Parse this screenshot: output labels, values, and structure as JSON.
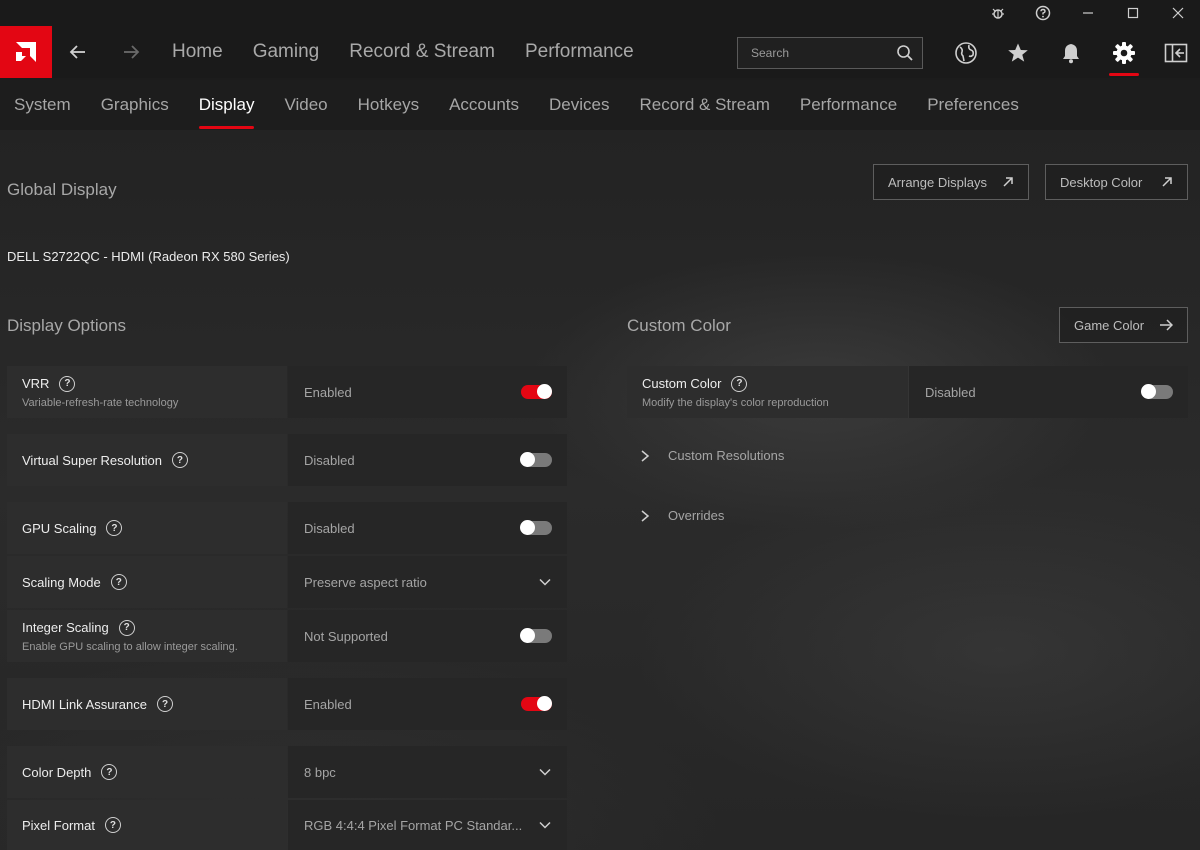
{
  "window_controls": [
    "bug-report",
    "help",
    "minimize",
    "maximize",
    "close"
  ],
  "header": {
    "main_nav": [
      "Home",
      "Gaming",
      "Record & Stream",
      "Performance"
    ],
    "search_placeholder": "Search",
    "icons": [
      "globe-icon",
      "star-icon",
      "bell-icon",
      "gear-icon",
      "sidebar-icon"
    ]
  },
  "subnav": {
    "tabs": [
      "System",
      "Graphics",
      "Display",
      "Video",
      "Hotkeys",
      "Accounts",
      "Devices",
      "Record & Stream",
      "Performance",
      "Preferences"
    ],
    "active": "Display"
  },
  "global": {
    "title": "Global Display",
    "arrange_btn": "Arrange Displays",
    "desktop_color_btn": "Desktop Color",
    "monitor": "DELL S2722QC - HDMI (Radeon RX 580 Series)"
  },
  "display_options": {
    "title": "Display Options",
    "rows": [
      {
        "label": "VRR",
        "desc": "Variable-refresh-rate technology",
        "value": "Enabled",
        "control": "toggle",
        "on": true
      },
      {
        "label": "Virtual Super Resolution",
        "desc": "",
        "value": "Disabled",
        "control": "toggle",
        "on": false
      },
      {
        "label": "GPU Scaling",
        "desc": "",
        "value": "Disabled",
        "control": "toggle",
        "on": false
      },
      {
        "label": "Scaling Mode",
        "desc": "",
        "value": "Preserve aspect ratio",
        "control": "dropdown"
      },
      {
        "label": "Integer Scaling",
        "desc": "Enable GPU scaling to allow integer scaling.",
        "value": "Not Supported",
        "control": "toggle",
        "on": false
      },
      {
        "label": "HDMI Link Assurance",
        "desc": "",
        "value": "Enabled",
        "control": "toggle",
        "on": true
      },
      {
        "label": "Color Depth",
        "desc": "",
        "value": "8 bpc",
        "control": "dropdown"
      },
      {
        "label": "Pixel Format",
        "desc": "",
        "value": "RGB 4:4:4 Pixel Format PC Standar...",
        "control": "dropdown"
      }
    ]
  },
  "custom_color": {
    "title": "Custom Color",
    "game_color_btn": "Game Color",
    "row": {
      "label": "Custom Color",
      "desc": "Modify the display's color reproduction",
      "value": "Disabled",
      "on": false
    },
    "expanders": [
      "Custom Resolutions",
      "Overrides"
    ]
  },
  "colors": {
    "accent": "#e30613"
  }
}
